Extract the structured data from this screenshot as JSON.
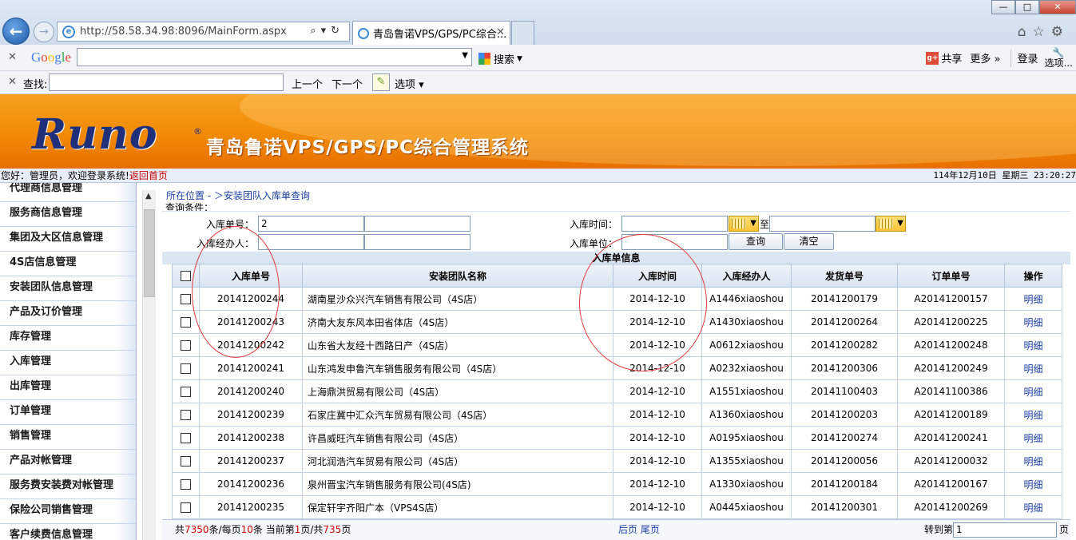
{
  "browser": {
    "url": "http://58.58.34.98:8096/MainForm.aspx",
    "tab_title": "青岛鲁诺VPS/GPS/PC综合...",
    "win_min": "—",
    "win_max": "□",
    "win_close": "✕"
  },
  "google_toolbar": {
    "logo": "Google",
    "search_btn": "搜索",
    "share": "共享",
    "more": "更多 »",
    "login": "登录",
    "options_line1": "选项",
    "options_line2": "..."
  },
  "find_bar": {
    "label": "查找:",
    "prev": "上一个",
    "next": "下一个",
    "options": "选项"
  },
  "banner": {
    "logo_text": "Runo",
    "registered": "®",
    "title": "青岛鲁诺VPS/GPS/PC综合管理系统"
  },
  "status": {
    "welcome": "您好：管理员，欢迎登录系统!",
    "back_home": "返回首页",
    "datetime": "114年12月10日 星期三 23:20:27"
  },
  "sidebar": {
    "items": [
      "代理商信息管理",
      "服务商信息管理",
      "集团及大区信息管理",
      "4S店信息管理",
      "安装团队信息管理",
      "产品及订价管理",
      "库存管理",
      "入库管理",
      "出库管理",
      "订单管理",
      "销售管理",
      "产品对帐管理",
      "服务费安装费对帐管理",
      "保险公司销售管理",
      "客户续费信息管理"
    ]
  },
  "breadcrumb": "所在位置 - ＞安装团队入库单查询",
  "query": {
    "section_label": "查询条件：",
    "order_no_label": "入库单号：",
    "order_no_value": "2",
    "handler_label": "入库经办人：",
    "time_label": "入库时间：",
    "to_label": "至",
    "unit_label": "入库单位：",
    "query_btn": "查询",
    "clear_btn": "清空"
  },
  "table": {
    "title": "入库单信息",
    "headers": [
      "入库单号",
      "安装团队名称",
      "入库时间",
      "入库经办人",
      "发货单号",
      "订单单号",
      "操作"
    ],
    "rows": [
      [
        "20141200244",
        "湖南星沙众兴汽车销售有限公司（4S店）",
        "2014-12-10",
        "A1446xiaoshou",
        "20141200179",
        "A20141200157",
        "明细"
      ],
      [
        "20141200243",
        "济南大友东风本田省体店（4S店）",
        "2014-12-10",
        "A1430xiaoshou",
        "20141200264",
        "A20141200225",
        "明细"
      ],
      [
        "20141200242",
        "山东省大友经十西路日产（4S店）",
        "2014-12-10",
        "A0612xiaoshou",
        "20141200282",
        "A20141200248",
        "明细"
      ],
      [
        "20141200241",
        "山东鸿发申鲁汽车销售服务有限公司（4S店）",
        "2014-12-10",
        "A0232xiaoshou",
        "20141200306",
        "A20141200249",
        "明细"
      ],
      [
        "20141200240",
        "上海鼎洪贸易有限公司（4S店）",
        "2014-12-10",
        "A1551xiaoshou",
        "20141100403",
        "A20141100386",
        "明细"
      ],
      [
        "20141200239",
        "石家庄冀中汇众汽车贸易有限公司（4S店）",
        "2014-12-10",
        "A1360xiaoshou",
        "20141200203",
        "A20141200189",
        "明细"
      ],
      [
        "20141200238",
        "许昌威旺汽车销售有限公司（4S店）",
        "2014-12-10",
        "A0195xiaoshou",
        "20141200274",
        "A20141200241",
        "明细"
      ],
      [
        "20141200237",
        "河北润浩汽车贸易有限公司（4S店）",
        "2014-12-10",
        "A1355xiaoshou",
        "20141200056",
        "A20141200032",
        "明细"
      ],
      [
        "20141200236",
        "泉州晋宝汽车销售服务有限公司(4S店)",
        "2014-12-10",
        "A1330xiaoshou",
        "20141200184",
        "A20141200167",
        "明细"
      ],
      [
        "20141200235",
        "保定轩宇齐阳广本（VPS4S店）",
        "2014-12-10",
        "A0445xiaoshou",
        "20141200301",
        "A20141200269",
        "明细"
      ]
    ]
  },
  "pager": {
    "p1": "共",
    "total_records": "7350",
    "p2": "条/每页",
    "page_size": "10",
    "p3": "条 当前第",
    "current_page": "1",
    "p4": "页/共",
    "total_pages": "735",
    "p5": "页",
    "nav": "后页 尾页",
    "goto_label": "转到第",
    "goto_value": "1",
    "goto_suffix": "页"
  },
  "colors": {
    "banner_orange": "#f18a06",
    "logo_blue": "#1f2f7a",
    "link_blue": "#1b3fa3",
    "annotation_red": "#e23b3b"
  }
}
